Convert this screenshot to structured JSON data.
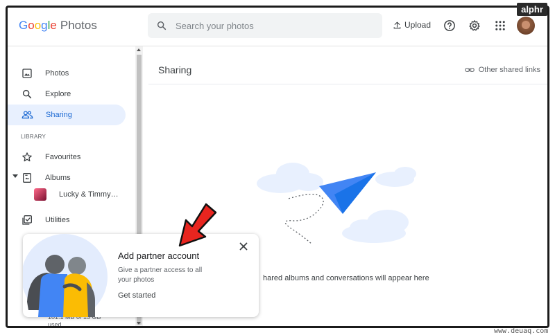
{
  "header": {
    "logo_letters": [
      "G",
      "o",
      "o",
      "g",
      "l",
      "e"
    ],
    "product": "Photos",
    "search_placeholder": "Search your photos",
    "upload_label": "Upload",
    "icons": [
      "help-icon",
      "settings-icon",
      "apps-icon"
    ]
  },
  "watermark": "alphr",
  "site_watermark": "www.deuaq.com",
  "sidebar": {
    "items": [
      {
        "label": "Photos",
        "icon": "photo-icon"
      },
      {
        "label": "Explore",
        "icon": "search-icon"
      },
      {
        "label": "Sharing",
        "icon": "people-icon",
        "active": true
      },
      {
        "label": "Favourites",
        "icon": "star-icon"
      },
      {
        "label": "Albums",
        "icon": "album-icon"
      },
      {
        "label": "Utilities",
        "icon": "utilities-icon"
      }
    ],
    "library_label": "LIBRARY",
    "album_sub": "Lucky & Timmy…",
    "storage_line1": "101.1 MB of 15 GB",
    "storage_line2": "used"
  },
  "main": {
    "title": "Sharing",
    "other_links": "Other shared links",
    "empty_text": "hared albums and conversations will appear here"
  },
  "popup": {
    "title": "Add partner account",
    "desc": "Give a partner access to all your photos",
    "cta": "Get started"
  },
  "colors": {
    "accent": "#1967d2",
    "active_bg": "#e8f0fe",
    "plane": "#4285f4",
    "arrow": "#e8251f"
  }
}
